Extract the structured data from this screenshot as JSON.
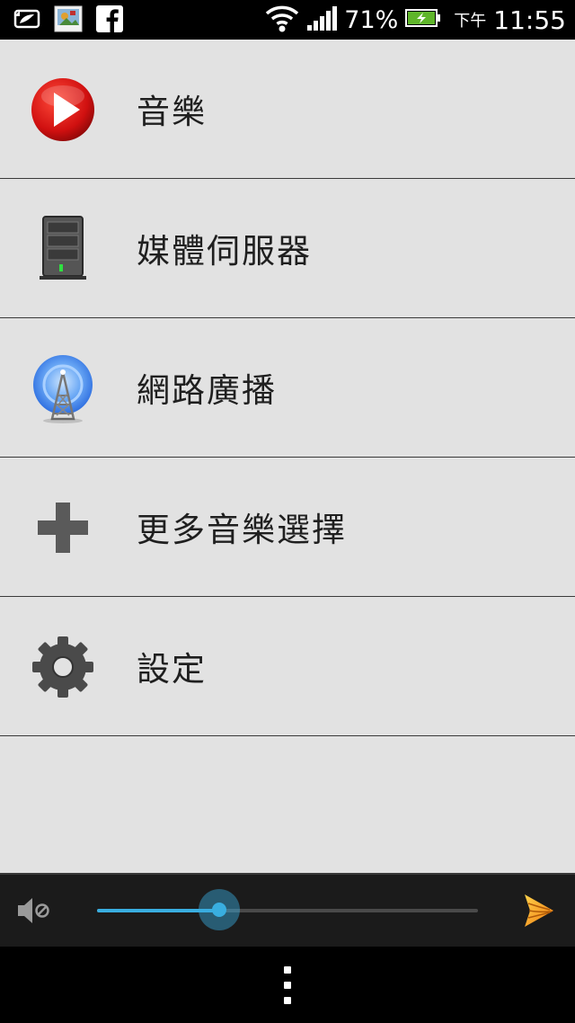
{
  "status_bar": {
    "notification_icons": [
      "evernote-icon",
      "photo-app-icon",
      "facebook-icon"
    ],
    "wifi_icon": "wifi-icon",
    "signal_icon": "signal-icon",
    "battery_percent": "71%",
    "battery_icon": "battery-charging-icon",
    "ampm": "下午",
    "time": "11:55"
  },
  "menu": {
    "items": [
      {
        "label": "音樂",
        "icon": "play-music-icon"
      },
      {
        "label": "媒體伺服器",
        "icon": "media-server-icon"
      },
      {
        "label": "網路廣播",
        "icon": "internet-radio-icon"
      },
      {
        "label": "更多音樂選擇",
        "icon": "plus-icon"
      },
      {
        "label": "設定",
        "icon": "gear-icon"
      }
    ]
  },
  "player": {
    "mute_icon": "volume-mute-icon",
    "volume_fraction": 0.32,
    "play_to_icon": "play-to-icon",
    "accent_color": "#39aee0"
  },
  "nav": {
    "menu_icon": "overflow-menu-icon"
  }
}
